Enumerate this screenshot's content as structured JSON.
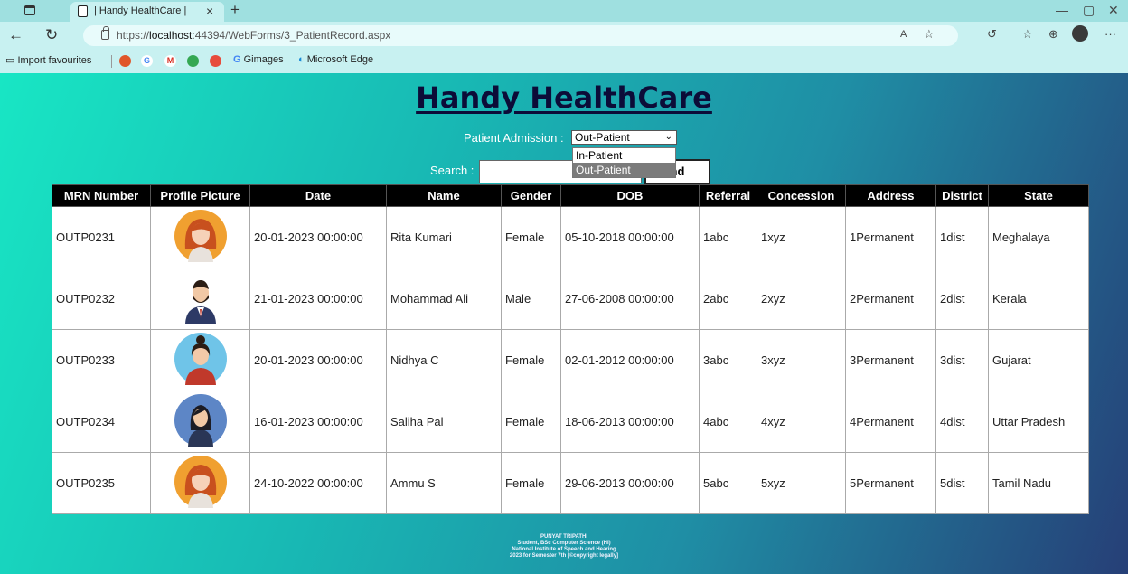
{
  "browser": {
    "tab_title": "| Handy HealthCare |",
    "new_tab": "+",
    "close_tab": "×",
    "url_prefix": "https://",
    "url_host": "localhost",
    "url_path": ":44394/WebForms/3_PatientRecord.aspx",
    "favourites": [
      "Import favourites",
      "Gimages",
      "Microsoft Edge"
    ],
    "window_controls": [
      "—",
      "▢",
      "✕"
    ]
  },
  "page": {
    "brand": "Handy HealthCare",
    "admission_label": "Patient Admission :",
    "admission_selected": "Out-Patient",
    "admission_options": [
      "In-Patient",
      "Out-Patient"
    ],
    "search_label": "Search :",
    "search_value": "",
    "find_button": "nd"
  },
  "table": {
    "headers": [
      "MRN Number",
      "Profile Picture",
      "Date",
      "Name",
      "Gender",
      "DOB",
      "Referral",
      "Concession",
      "Address",
      "District",
      "State"
    ],
    "rows": [
      {
        "mrn": "OUTP0231",
        "avatar": "woman-red-hair",
        "date": "20-01-2023 00:00:00",
        "name": "Rita Kumari",
        "gender": "Female",
        "dob": "05-10-2018 00:00:00",
        "referral": "1abc",
        "concession": "1xyz",
        "address": "1Permanent",
        "district": "1dist",
        "state": "Meghalaya"
      },
      {
        "mrn": "OUTP0232",
        "avatar": "man-beard-suit",
        "date": "21-01-2023 00:00:00",
        "name": "Mohammad Ali",
        "gender": "Male",
        "dob": "27-06-2008 00:00:00",
        "referral": "2abc",
        "concession": "2xyz",
        "address": "2Permanent",
        "district": "2dist",
        "state": "Kerala"
      },
      {
        "mrn": "OUTP0233",
        "avatar": "woman-bun-blue",
        "date": "20-01-2023 00:00:00",
        "name": "Nidhya C",
        "gender": "Female",
        "dob": "02-01-2012 00:00:00",
        "referral": "3abc",
        "concession": "3xyz",
        "address": "3Permanent",
        "district": "3dist",
        "state": "Gujarat"
      },
      {
        "mrn": "OUTP0234",
        "avatar": "woman-dark-blue",
        "date": "16-01-2023 00:00:00",
        "name": "Saliha Pal",
        "gender": "Female",
        "dob": "18-06-2013 00:00:00",
        "referral": "4abc",
        "concession": "4xyz",
        "address": "4Permanent",
        "district": "4dist",
        "state": "Uttar Pradesh"
      },
      {
        "mrn": "OUTP0235",
        "avatar": "woman-red-hair",
        "date": "24-10-2022 00:00:00",
        "name": "Ammu S",
        "gender": "Female",
        "dob": "29-06-2013 00:00:00",
        "referral": "5abc",
        "concession": "5xyz",
        "address": "5Permanent",
        "district": "5dist",
        "state": "Tamil Nadu"
      }
    ]
  },
  "footer": {
    "lines": [
      "PUNYAT TRIPATHI",
      "Student, BSc Computer Science (HI)",
      "National Institute of Speech and Hearing",
      "2023 for Semester 7th [©copyright legally]"
    ]
  },
  "colors": {
    "brand": "#0c0c38",
    "header_bg": "#000000",
    "page_gradient_start": "#18e6c4",
    "page_gradient_end": "#263f77"
  }
}
